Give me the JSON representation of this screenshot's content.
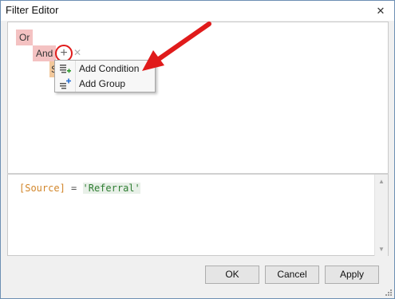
{
  "window": {
    "title": "Filter Editor",
    "close_glyph": "✕"
  },
  "tree": {
    "root_group": "Or",
    "sub_group": "And",
    "condition_stub": "S",
    "add_glyph": "+",
    "remove_glyph": "✕"
  },
  "context_menu": {
    "items": [
      {
        "label": "Add Condition",
        "icon": "add-condition-icon"
      },
      {
        "label": "Add Group",
        "icon": "add-group-icon"
      }
    ]
  },
  "expression": {
    "field": "[Source]",
    "operator": "=",
    "value": "'Referral'"
  },
  "buttons": {
    "ok": "OK",
    "cancel": "Cancel",
    "apply": "Apply"
  },
  "colors": {
    "group_bg": "#f4c2c2",
    "condition_bg": "#f2c89b",
    "annotation_red": "#e01b1b",
    "field_color": "#d2862a",
    "value_color": "#2e7d32"
  }
}
